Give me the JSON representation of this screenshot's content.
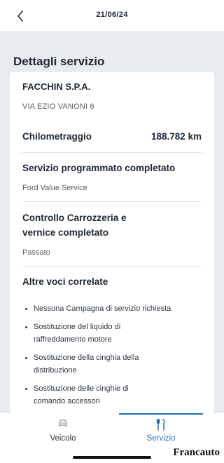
{
  "header": {
    "title": "21/06/24"
  },
  "page": {
    "title": "Dettagli servizio"
  },
  "dealer": {
    "name": "FACCHIN S.P.A.",
    "address": "VIA EZIO VANONI 6"
  },
  "mileage": {
    "label": "Chilometraggio",
    "value": "188.782 km"
  },
  "sections": [
    {
      "title": "Servizio programmato completato",
      "subtitle": "Ford Value Service"
    },
    {
      "title_line1": "Controllo Carrozzeria e",
      "title_line2": "vernice completato",
      "subtitle": "Passato"
    }
  ],
  "related": {
    "title": "Altre voci correlate",
    "items": [
      {
        "line1": "Nessuna Campagna di servizio richiesta",
        "line2": ""
      },
      {
        "line1": "Sostituzione del liquido di",
        "line2": "raffreddamento motore"
      },
      {
        "line1": "Sostituzione della cinghia della",
        "line2": "distribuzione"
      },
      {
        "line1": "Sostituzione delle cinghie di",
        "line2": "comando accessori"
      }
    ]
  },
  "tabs": [
    {
      "label": "Veicolo",
      "icon": "car-icon",
      "active": false
    },
    {
      "label": "Servizio",
      "icon": "service-tools-icon",
      "active": true
    }
  ],
  "watermark": "Francauto",
  "colors": {
    "accent": "#1f6fb5",
    "background": "#e8ecf1",
    "card": "#ffffff",
    "text": "#1c2733"
  }
}
